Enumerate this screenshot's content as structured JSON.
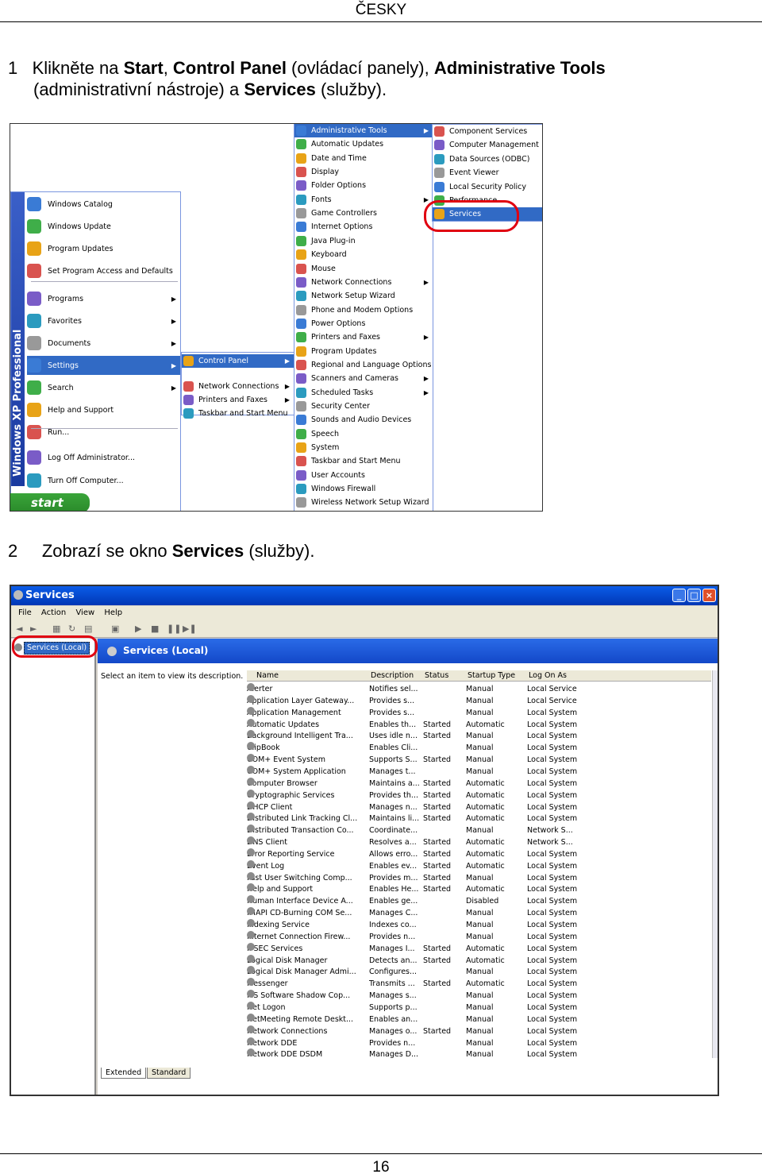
{
  "header": {
    "language": "ČESKY"
  },
  "step1": {
    "num": "1",
    "t1": "Klikněte na ",
    "b1": "Start",
    "t2": ", ",
    "b2": "Control Panel",
    "t3": " (ovládací panely), ",
    "b3": "Administrative Tools",
    "t4": "(administrativní nástroje) a ",
    "b4": "Services",
    "t5": " (služby)."
  },
  "step2": {
    "num": "2",
    "t1": "Zobrazí se okno ",
    "b1": "Services",
    "t2": " (služby)."
  },
  "start_menu": {
    "side_text": "Windows XP Professional",
    "start_label": "start",
    "top_items": [
      "Windows Catalog",
      "Windows Update",
      "Program Updates",
      "Set Program Access and Defaults"
    ],
    "mid_items": [
      "Programs",
      "Favorites",
      "Documents",
      "Settings",
      "Search",
      "Help and Support",
      "Run..."
    ],
    "bottom_items": [
      "Log Off Administrator...",
      "Turn Off Computer..."
    ],
    "settings_items": [
      "Control Panel",
      "Network Connections",
      "Printers and Faxes",
      "Taskbar and Start Menu"
    ],
    "control_panel_items": [
      "Administrative Tools",
      "Automatic Updates",
      "Date and Time",
      "Display",
      "Folder Options",
      "Fonts",
      "Game Controllers",
      "Internet Options",
      "Java Plug-in",
      "Keyboard",
      "Mouse",
      "Network Connections",
      "Network Setup Wizard",
      "Phone and Modem Options",
      "Power Options",
      "Printers and Faxes",
      "Program Updates",
      "Regional and Language Options",
      "Scanners and Cameras",
      "Scheduled Tasks",
      "Security Center",
      "Sounds and Audio Devices",
      "Speech",
      "System",
      "Taskbar and Start Menu",
      "User Accounts",
      "Windows Firewall",
      "Wireless Network Setup Wizard"
    ],
    "admin_tools_items": [
      "Component Services",
      "Computer Management",
      "Data Sources (ODBC)",
      "Event Viewer",
      "Local Security Policy",
      "Performance",
      "Services"
    ]
  },
  "services_window": {
    "title": "Services",
    "menu": [
      "File",
      "Action",
      "View",
      "Help"
    ],
    "tree_item": "Services (Local)",
    "panel_title": "Services (Local)",
    "description_hint": "Select an item to view its description.",
    "columns": [
      "Name",
      "Description",
      "Status",
      "Startup Type",
      "Log On As"
    ],
    "rows": [
      [
        "Alerter",
        "Notifies sel...",
        "",
        "Manual",
        "Local Service"
      ],
      [
        "Application Layer Gateway...",
        "Provides s...",
        "",
        "Manual",
        "Local Service"
      ],
      [
        "Application Management",
        "Provides s...",
        "",
        "Manual",
        "Local System"
      ],
      [
        "Automatic Updates",
        "Enables th...",
        "Started",
        "Automatic",
        "Local System"
      ],
      [
        "Background Intelligent Tra...",
        "Uses idle n...",
        "Started",
        "Manual",
        "Local System"
      ],
      [
        "ClipBook",
        "Enables Cli...",
        "",
        "Manual",
        "Local System"
      ],
      [
        "COM+ Event System",
        "Supports S...",
        "Started",
        "Manual",
        "Local System"
      ],
      [
        "COM+ System Application",
        "Manages t...",
        "",
        "Manual",
        "Local System"
      ],
      [
        "Computer Browser",
        "Maintains a...",
        "Started",
        "Automatic",
        "Local System"
      ],
      [
        "Cryptographic Services",
        "Provides th...",
        "Started",
        "Automatic",
        "Local System"
      ],
      [
        "DHCP Client",
        "Manages n...",
        "Started",
        "Automatic",
        "Local System"
      ],
      [
        "Distributed Link Tracking Cl...",
        "Maintains li...",
        "Started",
        "Automatic",
        "Local System"
      ],
      [
        "Distributed Transaction Co...",
        "Coordinate...",
        "",
        "Manual",
        "Network S..."
      ],
      [
        "DNS Client",
        "Resolves a...",
        "Started",
        "Automatic",
        "Network S..."
      ],
      [
        "Error Reporting Service",
        "Allows erro...",
        "Started",
        "Automatic",
        "Local System"
      ],
      [
        "Event Log",
        "Enables ev...",
        "Started",
        "Automatic",
        "Local System"
      ],
      [
        "Fast User Switching Comp...",
        "Provides m...",
        "Started",
        "Manual",
        "Local System"
      ],
      [
        "Help and Support",
        "Enables He...",
        "Started",
        "Automatic",
        "Local System"
      ],
      [
        "Human Interface Device A...",
        "Enables ge...",
        "",
        "Disabled",
        "Local System"
      ],
      [
        "IMAPI CD-Burning COM Se...",
        "Manages C...",
        "",
        "Manual",
        "Local System"
      ],
      [
        "Indexing Service",
        "Indexes co...",
        "",
        "Manual",
        "Local System"
      ],
      [
        "Internet Connection Firew...",
        "Provides n...",
        "",
        "Manual",
        "Local System"
      ],
      [
        "IPSEC Services",
        "Manages I...",
        "Started",
        "Automatic",
        "Local System"
      ],
      [
        "Logical Disk Manager",
        "Detects an...",
        "Started",
        "Automatic",
        "Local System"
      ],
      [
        "Logical Disk Manager Admi...",
        "Configures...",
        "",
        "Manual",
        "Local System"
      ],
      [
        "Messenger",
        "Transmits ...",
        "Started",
        "Automatic",
        "Local System"
      ],
      [
        "MS Software Shadow Cop...",
        "Manages s...",
        "",
        "Manual",
        "Local System"
      ],
      [
        "Net Logon",
        "Supports p...",
        "",
        "Manual",
        "Local System"
      ],
      [
        "NetMeeting Remote Deskt...",
        "Enables an...",
        "",
        "Manual",
        "Local System"
      ],
      [
        "Network Connections",
        "Manages o...",
        "Started",
        "Manual",
        "Local System"
      ],
      [
        "Network DDE",
        "Provides n...",
        "",
        "Manual",
        "Local System"
      ],
      [
        "Network DDE DSDM",
        "Manages D...",
        "",
        "Manual",
        "Local System"
      ]
    ],
    "tabs": [
      "Extended",
      "Standard"
    ]
  },
  "footer": {
    "page": "16"
  },
  "colors": {
    "xp_blue": "#316ac5",
    "highlight_red": "#e00010",
    "title_blue": "#0a5ce8"
  }
}
